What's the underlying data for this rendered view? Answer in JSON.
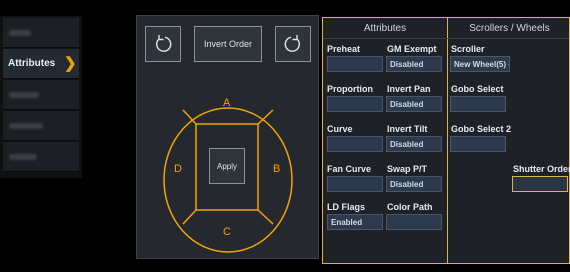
{
  "sidebar": {
    "active_label": "Attributes",
    "active_icon": "chevron-right-icon"
  },
  "swap": {
    "invert_label": "Invert Order",
    "apply_label": "Apply",
    "rotate_left_icon": "rotate-ccw-icon",
    "rotate_right_icon": "rotate-cw-icon",
    "sides": {
      "a": "A",
      "b": "B",
      "c": "C",
      "d": "D"
    },
    "accent": "#f0a400"
  },
  "attributes": {
    "header": "Attributes",
    "fields": {
      "preheat": {
        "label": "Preheat",
        "value": ""
      },
      "gm_exempt": {
        "label": "GM Exempt",
        "value": "Disabled"
      },
      "proportion": {
        "label": "Proportion",
        "value": ""
      },
      "invert_pan": {
        "label": "Invert Pan",
        "value": "Disabled"
      },
      "curve": {
        "label": "Curve",
        "value": ""
      },
      "invert_tilt": {
        "label": "Invert Tilt",
        "value": "Disabled"
      },
      "fan_curve": {
        "label": "Fan Curve",
        "value": ""
      },
      "swap_pt": {
        "label": "Swap P/T",
        "value": "Disabled"
      },
      "ld_flags": {
        "label": "LD Flags",
        "value": "Enabled"
      },
      "color_path": {
        "label": "Color Path",
        "value": ""
      }
    }
  },
  "scrollers": {
    "header": "Scrollers / Wheels",
    "fields": {
      "scroller": {
        "label": "Scroller",
        "value": "New Wheel(5) ~"
      },
      "gobo_select": {
        "label": "Gobo Select",
        "value": ""
      },
      "gobo_select_2": {
        "label": "Gobo Select 2",
        "value": ""
      },
      "shutter_order": {
        "label": "Shutter Order",
        "value": ""
      }
    }
  }
}
